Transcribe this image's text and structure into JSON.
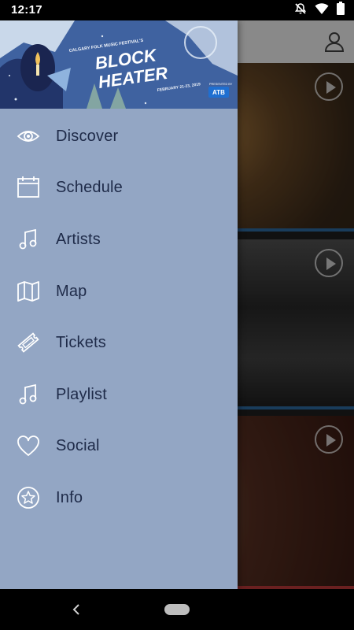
{
  "status_bar": {
    "time": "12:17"
  },
  "drawer": {
    "header": {
      "poster_lines": [
        "CALGARY FOLK MUSIC FESTIVAL'S",
        "BLOCK",
        "HEATER",
        "FEBRUARY 21-23, 2019",
        "PRESENTED BY",
        "ATB"
      ]
    },
    "items": [
      {
        "label": "Discover",
        "icon": "eye-icon"
      },
      {
        "label": "Schedule",
        "icon": "calendar-icon"
      },
      {
        "label": "Artists",
        "icon": "music-note-icon"
      },
      {
        "label": "Map",
        "icon": "map-icon"
      },
      {
        "label": "Tickets",
        "icon": "ticket-icon"
      },
      {
        "label": "Playlist",
        "icon": "music-note-icon"
      },
      {
        "label": "Social",
        "icon": "heart-icon"
      },
      {
        "label": "Info",
        "icon": "star-icon"
      }
    ]
  },
  "colors": {
    "drawer_bg": "#93a6c4",
    "drawer_text": "#1e2a48",
    "accent_blue": "#2f6ea7",
    "accent_red": "#c23b3b"
  }
}
